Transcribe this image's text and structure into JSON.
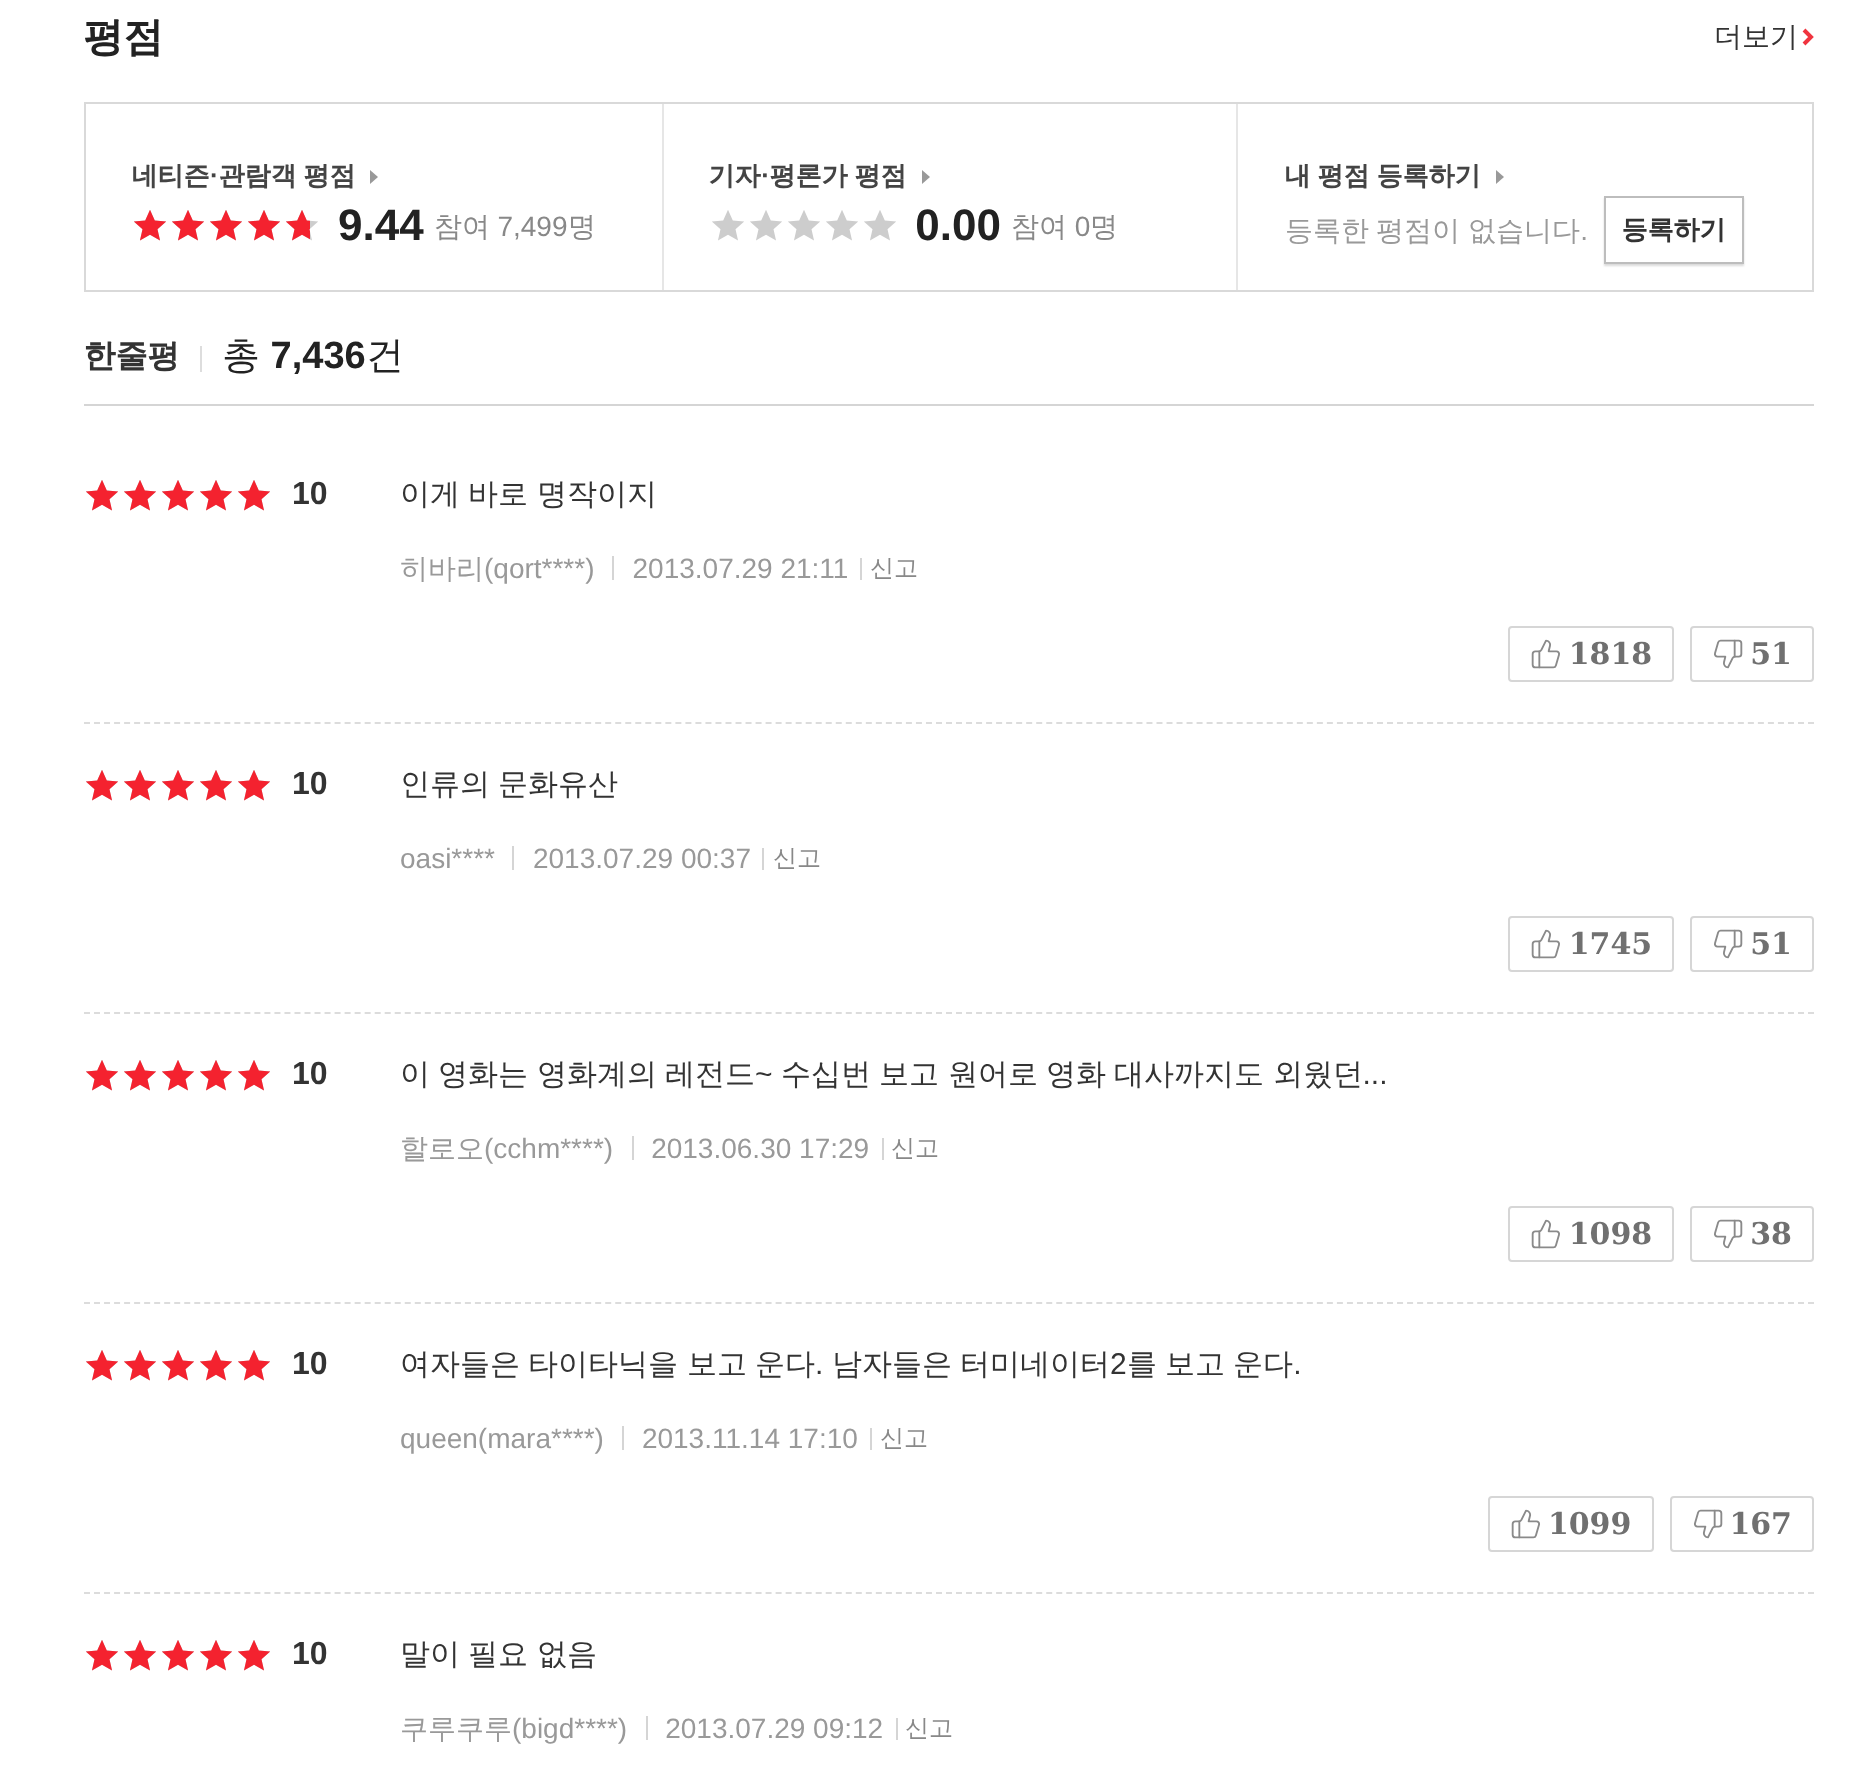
{
  "header": {
    "title": "평점",
    "more_link": "더보기"
  },
  "rating_summary": [
    {
      "kind": "score",
      "label": "네티즌·관람객 평점",
      "stars": 4.72,
      "score": "9.44",
      "participants": "참여 7,499명"
    },
    {
      "kind": "score",
      "label": "기자·평론가 평점",
      "stars": 0,
      "score": "0.00",
      "participants": "참여 0명"
    },
    {
      "kind": "register",
      "label": "내 평점 등록하기",
      "message": "등록한 평점이 없습니다.",
      "button": "등록하기"
    }
  ],
  "reviews_header": {
    "title": "한줄평",
    "total": "총 **7,436**건"
  },
  "reviews": [
    {
      "stars": 5,
      "score": "10",
      "text": "이게 바로 명작이지",
      "author": "히바리(qort****)",
      "date": "2013.07.29 21:11",
      "report": "신고",
      "likes": "1818",
      "dislikes": "51"
    },
    {
      "stars": 5,
      "score": "10",
      "text": "인류의 문화유산",
      "author": "oasi****",
      "date": "2013.07.29 00:37",
      "report": "신고",
      "likes": "1745",
      "dislikes": "51"
    },
    {
      "stars": 5,
      "score": "10",
      "text": "이 영화는 영화계의 레전드~ 수십번 보고 원어로 영화 대사까지도 외웠던...",
      "author": "할로오(cchm****)",
      "date": "2013.06.30 17:29",
      "report": "신고",
      "likes": "1098",
      "dislikes": "38"
    },
    {
      "stars": 5,
      "score": "10",
      "text": "여자들은 타이타닉을 보고 운다. 남자들은 터미네이터2를 보고 운다.",
      "author": "queen(mara****)",
      "date": "2013.11.14 17:10",
      "report": "신고",
      "likes": "1099",
      "dislikes": "167"
    },
    {
      "stars": 5,
      "score": "10",
      "text": "말이 필요 없음",
      "author": "쿠루쿠루(bigd****)",
      "date": "2013.07.29 09:12",
      "report": "신고"
    }
  ]
}
